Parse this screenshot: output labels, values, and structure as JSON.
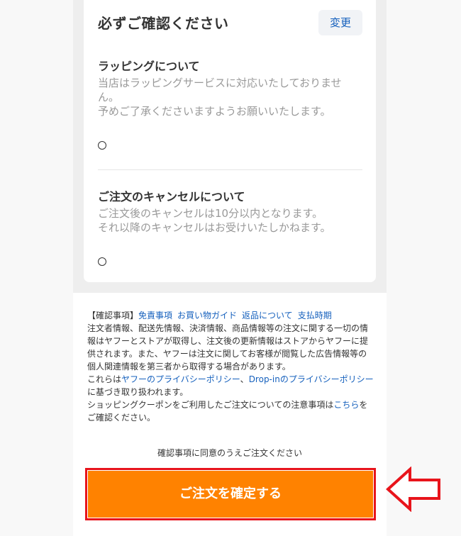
{
  "card": {
    "title": "必ずご確認ください",
    "change_label": "変更",
    "sections": [
      {
        "heading": "ラッピングについて",
        "lines": [
          "当店はラッピングサービスに対応いたしておりません。",
          "予めご了承くださいますようお願いいたします。"
        ]
      },
      {
        "heading": "ご注文のキャンセルについて",
        "lines": [
          "ご注文後のキャンセルは10分以内となります。",
          "それ以降のキャンセルはお受けいたしかねます。"
        ]
      }
    ]
  },
  "notice": {
    "prefix": "【確認事項】",
    "links": [
      "免責事項",
      "お買い物ガイド",
      "返品について",
      "支払時期"
    ],
    "para1": "注文者情報、配送先情報、決済情報、商品情報等の注文に関する一切の情報はヤフーとストアが取得し、注文後の更新情報はストアからヤフーに提供されます。また、ヤフーは注文に関してお客様が閲覧した広告情報等の個人関連情報を第三者から取得する場合があります。",
    "para2_start": "これらは",
    "privacy_yahoo": "ヤフーのプライバシーポリシー",
    "separator": "、",
    "privacy_dropin": "Drop-inのプライバシーポリシー",
    "para2_end": "に基づき取り扱われます。",
    "para3_start": "ショッピングクーポンをご利用したご注文についての注意事項は",
    "para3_link": "こちら",
    "para3_end": "をご確認ください。"
  },
  "agree_text": "確認事項に同意のうえご注文ください",
  "confirm_label": "ご注文を確定する",
  "colors": {
    "accent_orange": "#ff8200",
    "highlight_red": "#e8141b",
    "link_blue": "#1560bd"
  }
}
